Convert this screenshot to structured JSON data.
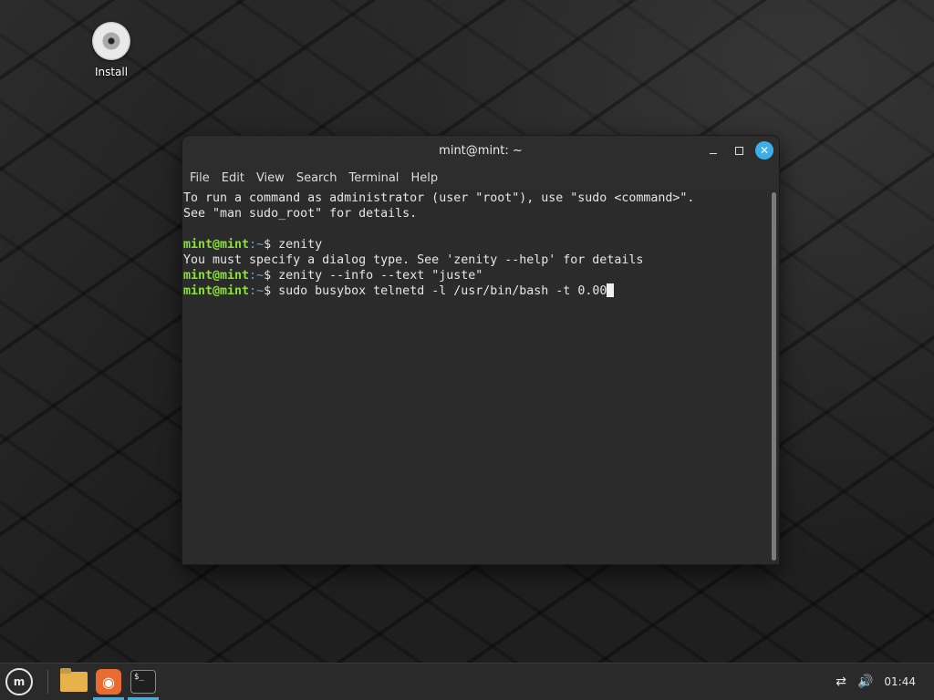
{
  "desktop": {
    "icons": [
      {
        "label": "Install",
        "icon": "disc-icon"
      }
    ]
  },
  "terminal": {
    "title": "mint@mint: ~",
    "menu": [
      "File",
      "Edit",
      "View",
      "Search",
      "Terminal",
      "Help"
    ],
    "lines": [
      {
        "type": "text",
        "text": "To run a command as administrator (user \"root\"), use \"sudo <command>\"."
      },
      {
        "type": "text",
        "text": "See \"man sudo_root\" for details."
      },
      {
        "type": "text",
        "text": ""
      },
      {
        "type": "prompt",
        "user": "mint@mint",
        "path": ":~",
        "sym": "$ ",
        "cmd": "zenity"
      },
      {
        "type": "text",
        "text": "You must specify a dialog type. See 'zenity --help' for details"
      },
      {
        "type": "prompt",
        "user": "mint@mint",
        "path": ":~",
        "sym": "$ ",
        "cmd": "zenity --info --text \"juste\""
      },
      {
        "type": "prompt",
        "user": "mint@mint",
        "path": ":~",
        "sym": "$ ",
        "cmd": "sudo busybox telnetd -l /usr/bin/bash -t 0.00",
        "cursor": true
      }
    ],
    "colors": {
      "prompt_user": "#8ae234",
      "prompt_path": "#729fcf",
      "close_button": "#3daee9"
    }
  },
  "taskbar": {
    "menu_icon": "linux-mint-logo-icon",
    "apps": [
      {
        "name": "files",
        "icon": "folder-icon",
        "active": false
      },
      {
        "name": "firefox",
        "icon": "firefox-icon",
        "active": true
      },
      {
        "name": "terminal",
        "icon": "terminal-icon",
        "active": true
      }
    ],
    "tray": {
      "network_icon": "network-disconnected-icon",
      "volume_icon": "volume-icon",
      "clock": "01:44"
    }
  }
}
